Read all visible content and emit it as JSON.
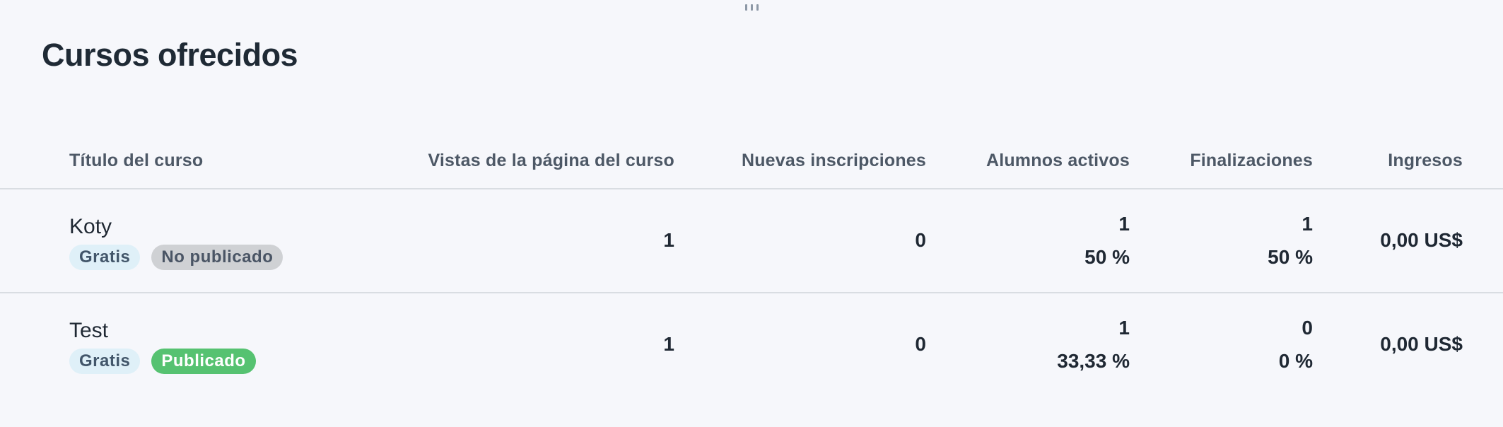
{
  "page_title": "Cursos ofrecidos",
  "table": {
    "headers": {
      "title": "Título del curso",
      "views": "Vistas de la página del curso",
      "new_enrollments": "Nuevas inscripciones",
      "active_students": "Alumnos activos",
      "completions": "Finalizaciones",
      "income": "Ingresos"
    },
    "rows": [
      {
        "title": "Koty",
        "price_badge": "Gratis",
        "status_badge": "No publicado",
        "status_color": "#cfd1d4",
        "views": "1",
        "new_enrollments": "0",
        "active_students": "1",
        "active_pct": "50 %",
        "completions": "1",
        "completions_pct": "50 %",
        "income": "0,00 US$"
      },
      {
        "title": "Test",
        "price_badge": "Gratis",
        "status_badge": "Publicado",
        "status_color": "#56c271",
        "views": "1",
        "new_enrollments": "0",
        "active_students": "1",
        "active_pct": "33,33 %",
        "completions": "0",
        "completions_pct": "0 %",
        "income": "0,00 US$"
      }
    ]
  },
  "icons": {
    "drag_handle": "drag-handle-icon"
  }
}
